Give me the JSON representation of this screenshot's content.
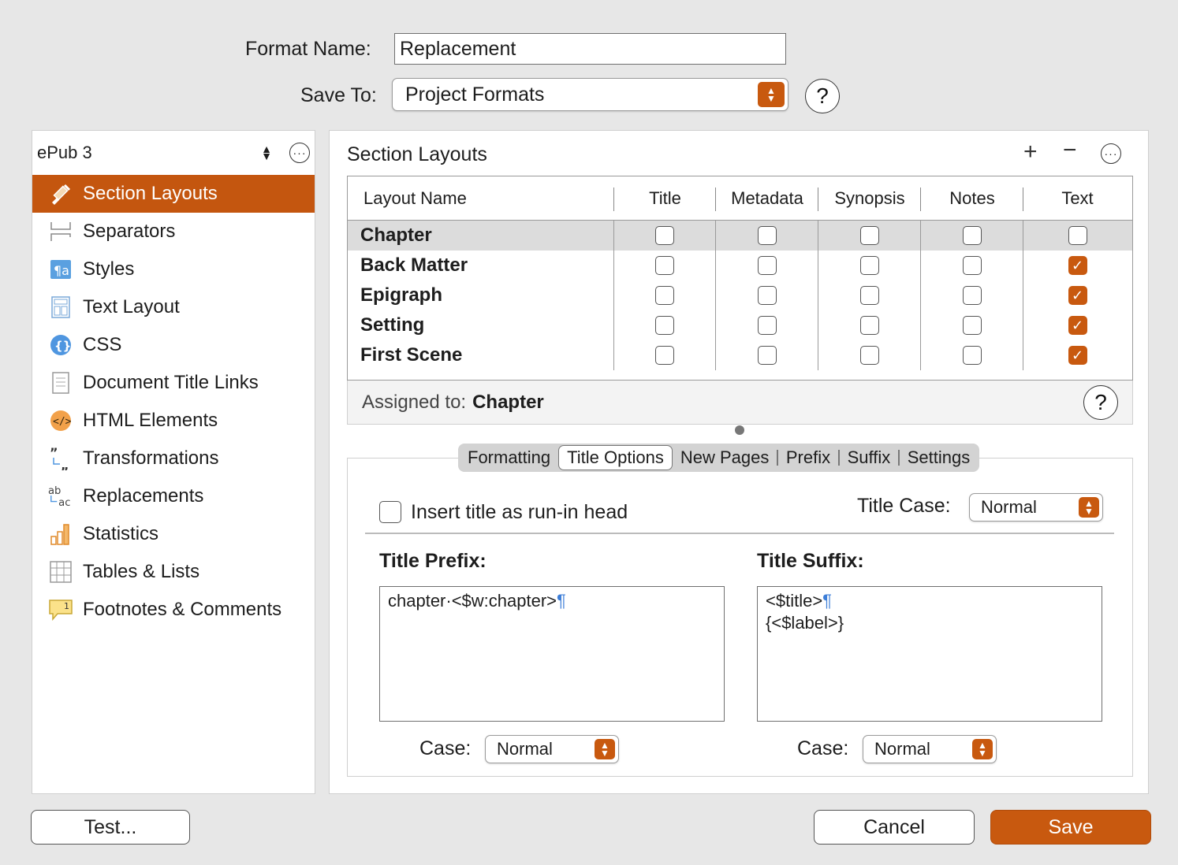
{
  "form": {
    "format_name_label": "Format Name:",
    "format_name_value": "Replacement",
    "save_to_label": "Save To:",
    "save_to_value": "Project Formats",
    "help": "?"
  },
  "sidebar": {
    "selector": "ePub 3",
    "items": [
      {
        "label": "Section Layouts",
        "icon": "paintbrush-icon"
      },
      {
        "label": "Separators",
        "icon": "separator-icon"
      },
      {
        "label": "Styles",
        "icon": "styles-icon"
      },
      {
        "label": "Text Layout",
        "icon": "text-layout-icon"
      },
      {
        "label": "CSS",
        "icon": "css-braces-icon"
      },
      {
        "label": "Document Title Links",
        "icon": "document-icon"
      },
      {
        "label": "HTML Elements",
        "icon": "html-code-icon"
      },
      {
        "label": "Transformations",
        "icon": "quotes-icon"
      },
      {
        "label": "Replacements",
        "icon": "replace-ab-icon"
      },
      {
        "label": "Statistics",
        "icon": "bar-chart-icon"
      },
      {
        "label": "Tables & Lists",
        "icon": "table-icon"
      },
      {
        "label": "Footnotes & Comments",
        "icon": "footnote-icon"
      }
    ]
  },
  "section_layouts": {
    "title": "Section Layouts",
    "columns": [
      "Layout Name",
      "Title",
      "Metadata",
      "Synopsis",
      "Notes",
      "Text"
    ],
    "rows": [
      {
        "name": "Chapter",
        "checks": [
          false,
          false,
          false,
          false,
          false
        ]
      },
      {
        "name": "Back Matter",
        "checks": [
          false,
          false,
          false,
          false,
          true
        ]
      },
      {
        "name": "Epigraph",
        "checks": [
          false,
          false,
          false,
          false,
          true
        ]
      },
      {
        "name": "Setting",
        "checks": [
          false,
          false,
          false,
          false,
          true
        ]
      },
      {
        "name": "First Scene",
        "checks": [
          false,
          false,
          false,
          false,
          true
        ]
      }
    ],
    "assigned_label": "Assigned to:",
    "assigned_value": "Chapter",
    "help": "?"
  },
  "tabs": [
    "Formatting",
    "Title Options",
    "New Pages",
    "Prefix",
    "Suffix",
    "Settings"
  ],
  "title_options": {
    "run_in_label": "Insert title as run-in head",
    "title_case_label": "Title Case:",
    "title_case_value": "Normal",
    "prefix_label": "Title Prefix:",
    "prefix_text": "chapter·<$w:chapter>",
    "suffix_label": "Title Suffix:",
    "suffix_line1": "<$title>",
    "suffix_line2": "{<$label>}",
    "pilcrow": "¶",
    "case_label": "Case:",
    "prefix_case": "Normal",
    "suffix_case": "Normal"
  },
  "footer": {
    "test_label": "Test...",
    "cancel_label": "Cancel",
    "save_label": "Save"
  },
  "colors": {
    "accent": "#c8590f",
    "pilcrow": "#3d7ed8"
  }
}
